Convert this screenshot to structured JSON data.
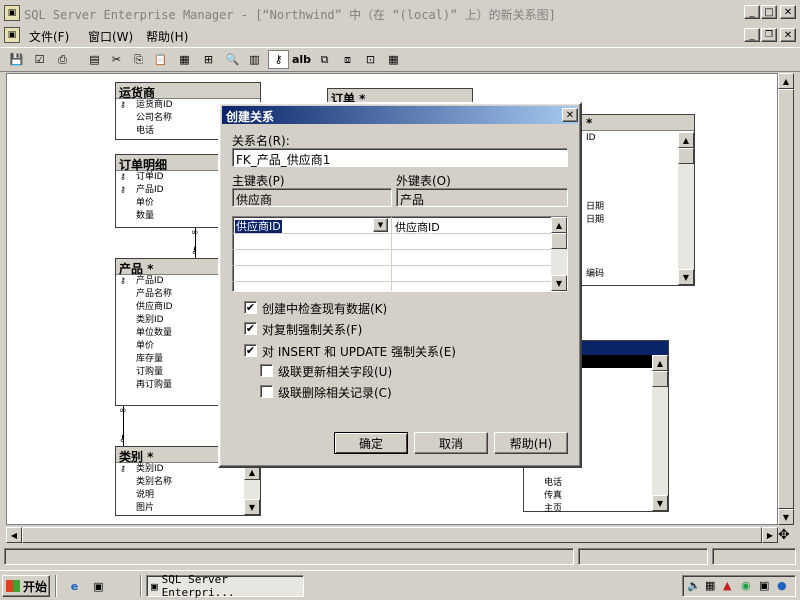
{
  "window": {
    "title": "SQL Server Enterprise Manager - [“Northwind” 中（在 “(local)” 上）的新关系图]"
  },
  "menu": {
    "file": "文件(F)",
    "window": "窗口(W)",
    "help": "帮助(H)"
  },
  "toolbar": {
    "ab_label": "alb"
  },
  "tables": {
    "shippers": {
      "title": "运货商",
      "columns": [
        "运货商ID",
        "公司名称",
        "电话"
      ]
    },
    "order_details": {
      "title": "订单明细",
      "columns": [
        "订单ID",
        "产品ID",
        "单价",
        "数量"
      ]
    },
    "products": {
      "title": "产品 *",
      "columns": [
        "产品ID",
        "产品名称",
        "供应商ID",
        "类别ID",
        "单位数量",
        "单价",
        "库存量",
        "订购量",
        "再订购量"
      ]
    },
    "categories": {
      "title": "类别 *",
      "columns": [
        "类别ID",
        "类别名称",
        "说明",
        "图片"
      ]
    },
    "orders": {
      "title": "订单 *",
      "visible_fragments": [
        "ID",
        "日期",
        "日期",
        "编码"
      ]
    },
    "right_fragment": {
      "title": "*"
    },
    "suppliers_fragment": {
      "columns": [
        "电话",
        "传真",
        "主页"
      ]
    }
  },
  "dialog": {
    "title": "创建关系",
    "rel_name_label": "关系名(R):",
    "rel_name_value": "FK_产品_供应商1",
    "pk_table_label": "主键表(P)",
    "pk_table_value": "供应商",
    "fk_table_label": "外键表(O)",
    "fk_table_value": "产品",
    "grid": {
      "pk_column": "供应商ID",
      "fk_column": "供应商ID"
    },
    "options": [
      {
        "label": "创建中检查现有数据(K)",
        "checked": true
      },
      {
        "label": "对复制强制关系(F)",
        "checked": true
      },
      {
        "label": "对 INSERT 和 UPDATE 强制关系(E)",
        "checked": true
      },
      {
        "label": "级联更新相关字段(U)",
        "checked": false
      },
      {
        "label": "级联删除相关记录(C)",
        "checked": false
      }
    ],
    "buttons": {
      "ok": "确定",
      "cancel": "取消",
      "help": "帮助(H)"
    },
    "check_mark": "✔"
  },
  "taskbar": {
    "start": "开始",
    "task": "SQL Server Enterpri..."
  },
  "colors": {
    "title_blue": "#0a246a",
    "desktop_bg": "#ffffff",
    "face": "#d4d0c8"
  }
}
